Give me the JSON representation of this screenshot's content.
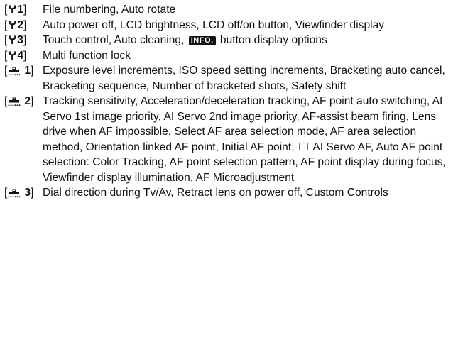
{
  "entries": [
    {
      "num": "1",
      "text": "File numbering, Auto rotate"
    },
    {
      "num": "2",
      "text": "Auto power off, LCD brightness, LCD off/on button, Viewfinder display"
    },
    {
      "num": "3",
      "text_before": "Touch control, Auto cleaning,",
      "badge": "INFO.",
      "text_after": "button display options"
    },
    {
      "num": "4",
      "text": "Multi function lock"
    },
    {
      "num": "1",
      "text": "Exposure level increments, ISO speed setting increments, Bracketing auto cancel, Bracketing sequence, Number of bracketed shots, Safety shift"
    },
    {
      "num": "2",
      "text_before": "Tracking sensitivity, Acceleration/deceleration tracking, AF point auto switching, AI Servo 1st image priority, AI Servo 2nd image priority, AF-assist beam firing, Lens drive when AF impossible, Select AF area selection mode, AF area selection method, Orientation linked AF point, Initial AF point,",
      "text_after": "AI Servo AF, Auto AF point selection: Color Tracking, AF point selection pattern, AF point display during focus, Viewfinder display illumination, AF Microadjustment"
    },
    {
      "num": "3",
      "text": "Dial direction during Tv/Av, Retract lens on power off, Custom Controls"
    }
  ],
  "icons": {
    "setup": "wrench-icon",
    "custom": "camera-icon",
    "af_area": "af-area-zone-icon"
  },
  "colors": {
    "text": "#111111",
    "badge_bg": "#111111",
    "badge_fg": "#ffffff"
  }
}
